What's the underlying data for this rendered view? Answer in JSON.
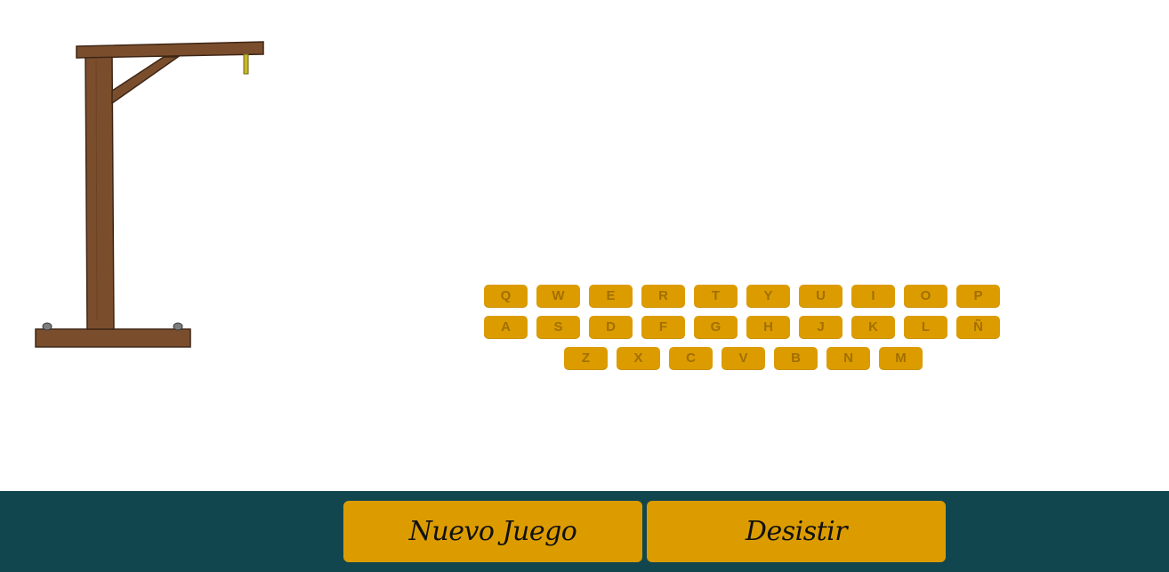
{
  "keyboard": {
    "rows": [
      [
        "Q",
        "W",
        "E",
        "R",
        "T",
        "Y",
        "U",
        "I",
        "O",
        "P"
      ],
      [
        "A",
        "S",
        "D",
        "F",
        "G",
        "H",
        "J",
        "K",
        "L",
        "Ñ"
      ],
      [
        "Z",
        "X",
        "C",
        "V",
        "B",
        "N",
        "M"
      ]
    ]
  },
  "footer": {
    "new_game_label": "Nuevo Juego",
    "quit_label": "Desistir"
  },
  "colors": {
    "key_background": "#dc9c00",
    "key_text": "#a26f00",
    "footer_background": "#12464f",
    "button_background": "#dc9c00",
    "wood": "#7a4e2d",
    "rope": "#c8b82a"
  },
  "icons": {
    "gallows": "hangman-gallows-icon"
  }
}
